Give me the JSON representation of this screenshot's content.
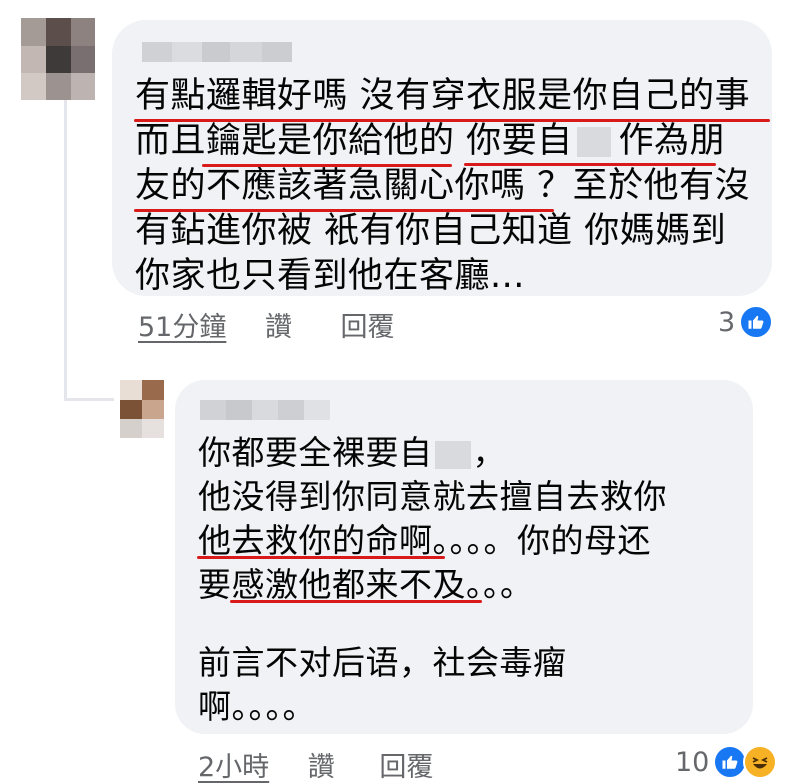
{
  "comment1": {
    "lines": [
      "有點邏輯好嗎 沒有穿衣服是你自己的事",
      "而且鑰匙是你給他的 你要自",
      "作為朋",
      "友的不應該著急關心你嗎 ？至於他有沒",
      "有鉆進你被 衹有你自己知道 你媽媽到",
      "你家也只看到他在客廳..."
    ],
    "time": "51分鐘",
    "like_label": "讚",
    "reply_label": "回覆",
    "reaction_count": "3",
    "reactions": [
      "like-icon"
    ]
  },
  "comment2": {
    "lines": [
      "你都要全裸要自",
      "，",
      "他没得到你同意就去擅自去救你",
      "他去救你的命啊。。。。你的母还",
      "要感激他都来不及。。。",
      "前言不对后语，社会毒瘤",
      "啊。。。。"
    ],
    "time": "2小時",
    "like_label": "讚",
    "reply_label": "回覆",
    "reaction_count": "10",
    "reactions": [
      "like-icon",
      "haha-icon"
    ]
  },
  "colors": {
    "bubble": "#f0f2f5",
    "underline": "#d91a1a",
    "meta": "#65676b",
    "like": "#1877f2",
    "haha": "#f7b125"
  }
}
